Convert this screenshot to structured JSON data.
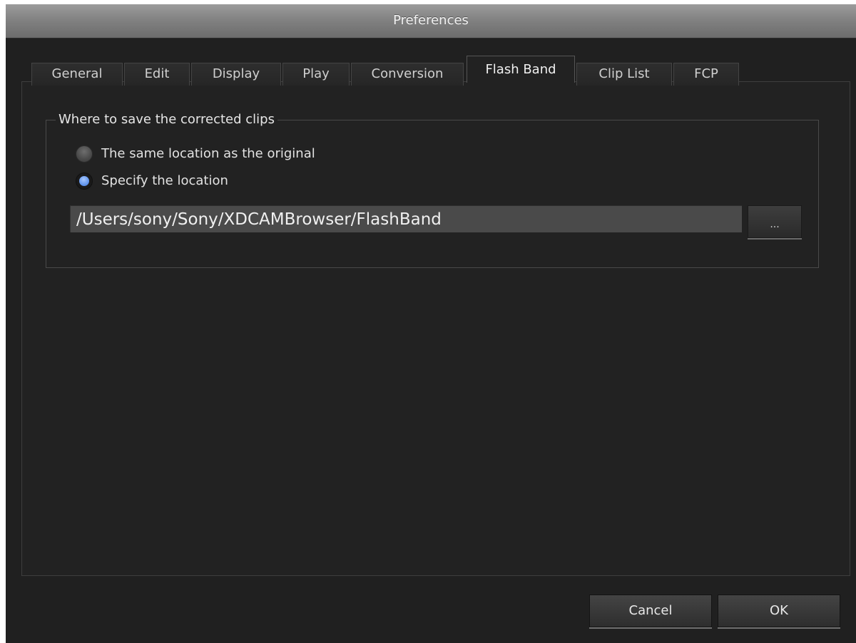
{
  "window": {
    "title": "Preferences"
  },
  "tabs": [
    {
      "label": "General",
      "active": false
    },
    {
      "label": "Edit",
      "active": false
    },
    {
      "label": "Display",
      "active": false
    },
    {
      "label": "Play",
      "active": false
    },
    {
      "label": "Conversion",
      "active": false
    },
    {
      "label": "Flash Band",
      "active": true
    },
    {
      "label": "Clip List",
      "active": false
    },
    {
      "label": "FCP",
      "active": false
    }
  ],
  "save_location": {
    "group_label": "Where to save the corrected clips",
    "options": [
      {
        "label": "The same location as the original",
        "selected": false
      },
      {
        "label": "Specify the location",
        "selected": true
      }
    ],
    "path_value": "/Users/sony/Sony/XDCAMBrowser/FlashBand",
    "browse_label": "..."
  },
  "footer": {
    "cancel_label": "Cancel",
    "ok_label": "OK"
  },
  "colors": {
    "background": "#202020",
    "titlebar": "#8a8a8a",
    "radio_selected": "#6a9cf0",
    "path_field": "#4a4a4a"
  }
}
